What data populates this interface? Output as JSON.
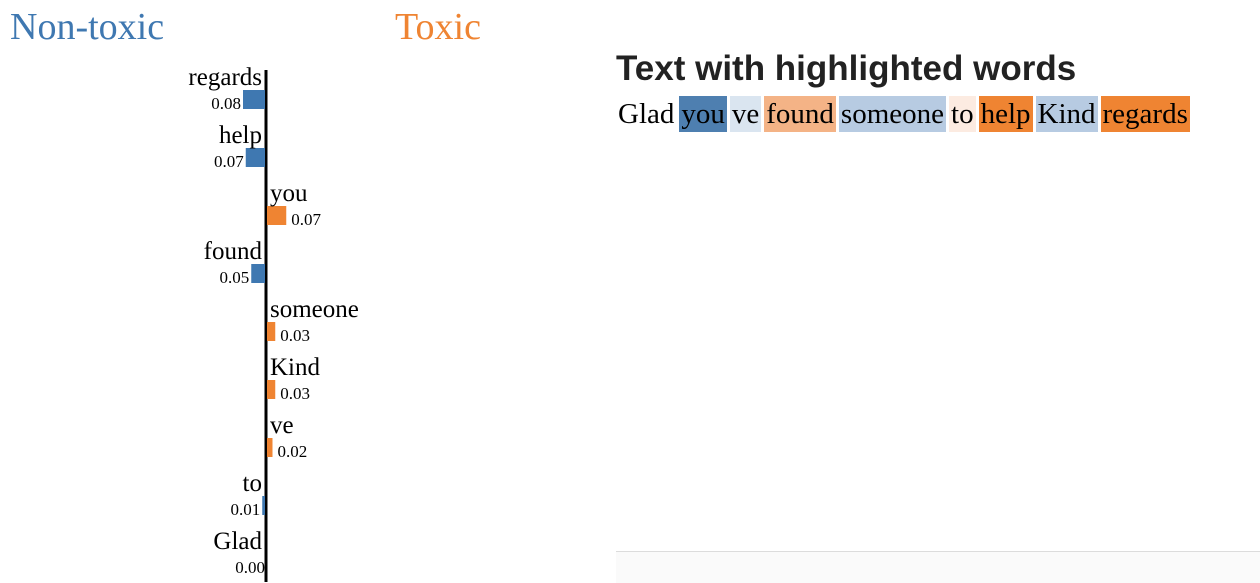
{
  "legend": {
    "nontoxic_label": "Non-toxic",
    "toxic_label": "Toxic",
    "nontoxic_color": "#3f78b1",
    "toxic_color": "#ef8432"
  },
  "chart_data": {
    "type": "bar",
    "orientation": "horizontal",
    "classes": [
      "Non-toxic",
      "Toxic"
    ],
    "categories": [
      "regards",
      "help",
      "you",
      "found",
      "someone",
      "Kind",
      "ve",
      "to",
      "Glad"
    ],
    "values": [
      -0.08,
      -0.07,
      0.07,
      -0.05,
      0.03,
      0.03,
      0.02,
      -0.01,
      0.0
    ],
    "value_labels": [
      "0.08",
      "0.07",
      "0.07",
      "0.05",
      "0.03",
      "0.03",
      "0.02",
      "0.01",
      "0.00"
    ],
    "colors": [
      "#3f78b1",
      "#ef8432"
    ],
    "grid": false
  },
  "panel": {
    "title": "Text with highlighted words",
    "words": [
      {
        "text": "Glad",
        "color": "#ffffff"
      },
      {
        "text": "you",
        "color": "#4e7fb0"
      },
      {
        "text": "ve",
        "color": "#dae5f0"
      },
      {
        "text": "found",
        "color": "#f4b386"
      },
      {
        "text": "someone",
        "color": "#b7cbe2"
      },
      {
        "text": "to",
        "color": "#fcebe1"
      },
      {
        "text": "help",
        "color": "#ef8432"
      },
      {
        "text": "Kind",
        "color": "#b7cbe2"
      },
      {
        "text": "regards",
        "color": "#ef8432"
      }
    ]
  }
}
